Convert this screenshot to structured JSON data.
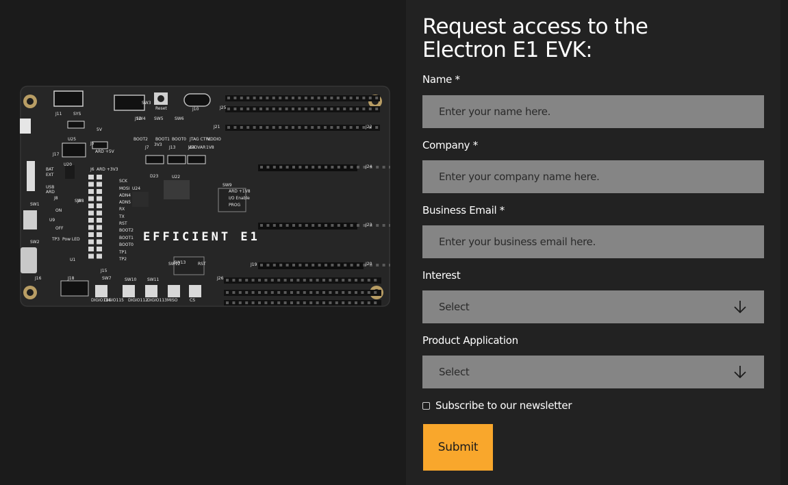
{
  "board": {
    "alt": "Electron E1 EVK board",
    "brand": "EFFICIENT E1",
    "silkscreen": [
      "J11",
      "SYS",
      "J25",
      "J10",
      "SW3",
      "Reset",
      "J21",
      "J22",
      "J24",
      "J23",
      "J20",
      "J26",
      "J19",
      "J18",
      "J16",
      "J15",
      "J17",
      "J12",
      "J13",
      "J14",
      "J5",
      "J6",
      "J7",
      "J8",
      "J9",
      "SW1",
      "SW2",
      "SW4",
      "SW5",
      "SW6",
      "SW7",
      "SW8",
      "SW9",
      "SW10",
      "SW11",
      "SW12",
      "SW13",
      "BAT",
      "EXT",
      "USB",
      "ARD",
      "ON",
      "OFF",
      "BOOT2",
      "BOOT1",
      "BOOT0",
      "JTAG CTRL",
      "VDDIO",
      "VDDVAR",
      "1V8",
      "3V3",
      "5V",
      "ARD +5V",
      "ARD +3V3",
      "ARD +1V8",
      "I/O Enable",
      "PROG",
      "RST",
      "DIGIO114",
      "DIGIO115",
      "DIGIO112",
      "DIGIO113",
      "MISO",
      "CS",
      "SCK",
      "MOSI",
      "ADN4",
      "ADN5",
      "RX",
      "TX",
      "RST",
      "BOOT2",
      "BOOT1",
      "BOOT0",
      "TP1",
      "TP2",
      "TP3",
      "Pow LED",
      "U1",
      "U9",
      "U20",
      "U22",
      "U24",
      "U25",
      "D23"
    ]
  },
  "form": {
    "title": "Request access to the Electron E1 EVK:",
    "name_label": "Name *",
    "name_placeholder": "Enter your name here.",
    "company_label": "Company *",
    "company_placeholder": "Enter your company name here.",
    "email_label": "Business Email *",
    "email_placeholder": "Enter your business email here.",
    "interest_label": "Interest",
    "interest_value": "Select",
    "application_label": "Product Application",
    "application_value": "Select",
    "newsletter_label": "Subscribe to our newsletter",
    "newsletter_checked": false,
    "submit_label": "Submit"
  },
  "colors": {
    "page_bg": "#1b1b1b",
    "panel_bg": "#222222",
    "input_bg": "#858585",
    "accent": "#f9a72c",
    "board": "#232323"
  },
  "icons": [
    "arrow-down-icon"
  ]
}
